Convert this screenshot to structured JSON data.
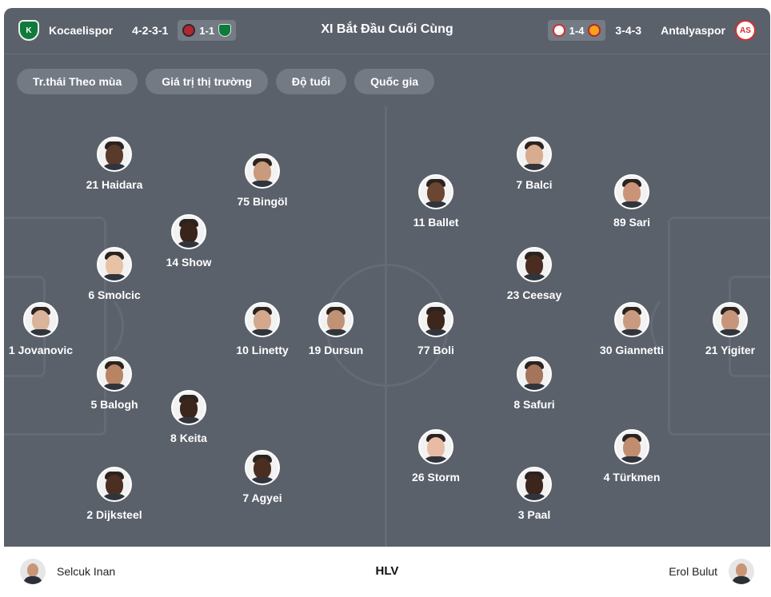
{
  "header": {
    "title": "XI Bắt Đầu Cuối Cùng",
    "home": {
      "name": "Kocaelispor",
      "formation": "4-2-3-1",
      "last_result": "1-1",
      "logo_text": "K"
    },
    "away": {
      "name": "Antalyaspor",
      "formation": "3-4-3",
      "last_result": "1-4",
      "logo_text": "AS"
    }
  },
  "filters": [
    {
      "label": "Tr.thái Theo mùa"
    },
    {
      "label": "Giá trị thị trường"
    },
    {
      "label": "Độ tuổi"
    },
    {
      "label": "Quốc gia"
    }
  ],
  "home_players": [
    {
      "label": "21 Haidara",
      "skin": "#5a3a2a"
    },
    {
      "label": "75 Bingöl",
      "skin": "#c99a7b"
    },
    {
      "label": "14 Show",
      "skin": "#3a2419"
    },
    {
      "label": "6 Smolcic",
      "skin": "#e7c2a5"
    },
    {
      "label": "1 Jovanovic",
      "skin": "#d9b39a"
    },
    {
      "label": "10 Linetty",
      "skin": "#d4a88c"
    },
    {
      "label": "19 Dursun",
      "skin": "#c19276"
    },
    {
      "label": "5 Balogh",
      "skin": "#b98463"
    },
    {
      "label": "8 Keita",
      "skin": "#3b261c"
    },
    {
      "label": "7 Agyei",
      "skin": "#4a2e20"
    },
    {
      "label": "2 Dijksteel",
      "skin": "#4b2f22"
    }
  ],
  "away_players": [
    {
      "label": "7 Balci",
      "skin": "#d8ac8f"
    },
    {
      "label": "11 Ballet",
      "skin": "#6b4631"
    },
    {
      "label": "89 Sari",
      "skin": "#c99478"
    },
    {
      "label": "23 Ceesay",
      "skin": "#4a2d20"
    },
    {
      "label": "77 Boli",
      "skin": "#3d271c"
    },
    {
      "label": "30 Giannetti",
      "skin": "#c89b80"
    },
    {
      "label": "21 Yigiter",
      "skin": "#c7967a"
    },
    {
      "label": "8 Safuri",
      "skin": "#a4755a"
    },
    {
      "label": "26 Storm",
      "skin": "#e8bca4"
    },
    {
      "label": "4 Türkmen",
      "skin": "#c08d6f"
    },
    {
      "label": "3 Paal",
      "skin": "#3c261b"
    }
  ],
  "coaches": {
    "label": "HLV",
    "home": "Selcuk Inan",
    "away": "Erol Bulut"
  }
}
